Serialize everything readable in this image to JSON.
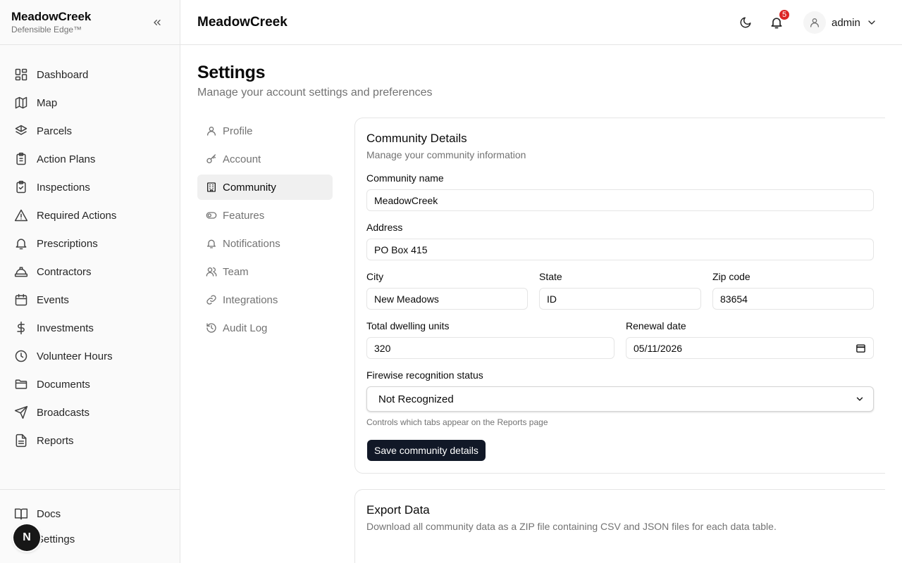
{
  "app": {
    "name": "MeadowCreek",
    "tagline": "Defensible Edge™",
    "header_title": "MeadowCreek",
    "notification_count": "5",
    "user_name": "admin",
    "fab_letter": "N"
  },
  "sidebar": {
    "items": [
      {
        "label": "Dashboard",
        "icon": "dashboard-icon"
      },
      {
        "label": "Map",
        "icon": "map-icon"
      },
      {
        "label": "Parcels",
        "icon": "parcels-icon"
      },
      {
        "label": "Action Plans",
        "icon": "clipboard-icon"
      },
      {
        "label": "Inspections",
        "icon": "clipboard-check-icon"
      },
      {
        "label": "Required Actions",
        "icon": "warning-icon"
      },
      {
        "label": "Prescriptions",
        "icon": "bell-icon"
      },
      {
        "label": "Contractors",
        "icon": "hardhat-icon"
      },
      {
        "label": "Events",
        "icon": "calendar-icon"
      },
      {
        "label": "Investments",
        "icon": "dollar-icon"
      },
      {
        "label": "Volunteer Hours",
        "icon": "clock-icon"
      },
      {
        "label": "Documents",
        "icon": "folder-icon"
      },
      {
        "label": "Broadcasts",
        "icon": "send-icon"
      },
      {
        "label": "Reports",
        "icon": "file-icon"
      }
    ],
    "bottom": [
      {
        "label": "Docs",
        "icon": "book-icon"
      },
      {
        "label": "Settings",
        "icon": "settings-icon"
      }
    ]
  },
  "page": {
    "title": "Settings",
    "subtitle": "Manage your account settings and preferences"
  },
  "settings_nav": [
    {
      "label": "Profile"
    },
    {
      "label": "Account"
    },
    {
      "label": "Community"
    },
    {
      "label": "Features"
    },
    {
      "label": "Notifications"
    },
    {
      "label": "Team"
    },
    {
      "label": "Integrations"
    },
    {
      "label": "Audit Log"
    }
  ],
  "community": {
    "title": "Community Details",
    "description": "Manage your community information",
    "name_label": "Community name",
    "name_value": "MeadowCreek",
    "address_label": "Address",
    "address_value": "PO Box 415",
    "city_label": "City",
    "city_value": "New Meadows",
    "state_label": "State",
    "state_value": "ID",
    "zip_label": "Zip code",
    "zip_value": "83654",
    "units_label": "Total dwelling units",
    "units_value": "320",
    "renewal_label": "Renewal date",
    "renewal_value": "05/11/2026",
    "firewise_label": "Firewise recognition status",
    "firewise_value": "Not Recognized",
    "firewise_hint": "Controls which tabs appear on the Reports page",
    "save_label": "Save community details"
  },
  "export": {
    "title": "Export Data",
    "description": "Download all community data as a ZIP file containing CSV and JSON files for each data table."
  },
  "colors": {
    "accent_button": "#111827",
    "badge": "#dc2626",
    "active_nav_bg": "#f0f0f0"
  }
}
